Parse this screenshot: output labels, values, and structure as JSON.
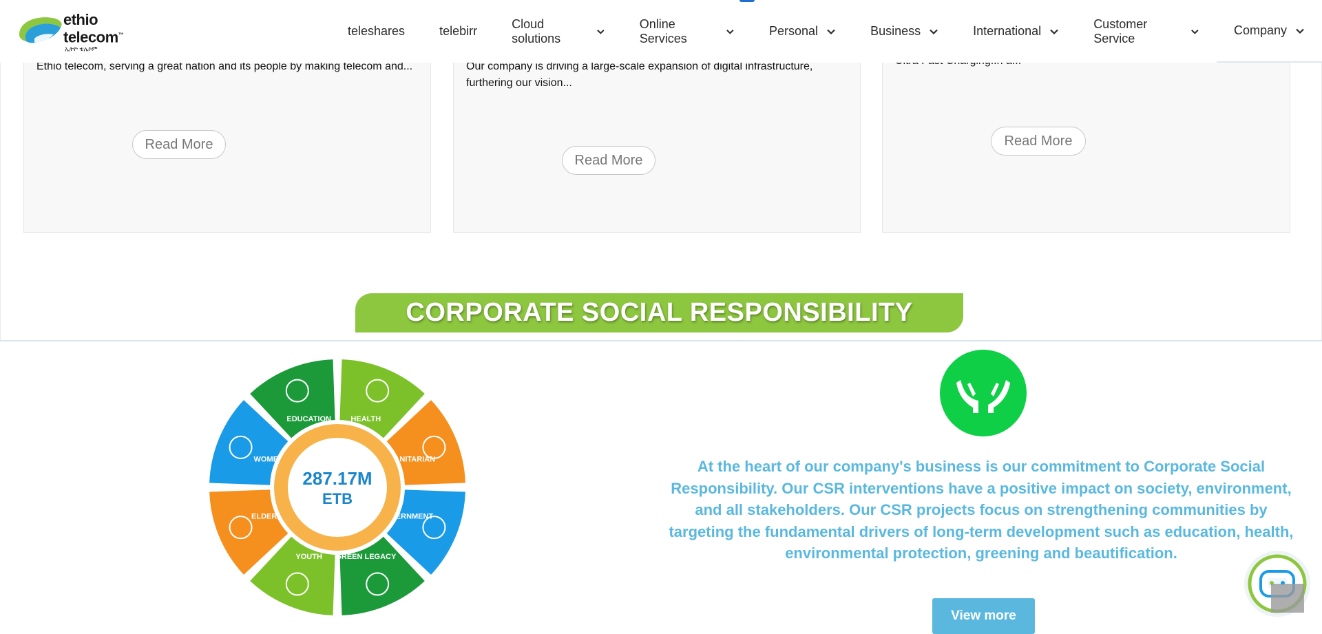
{
  "header": {
    "logo_name": "ethio telecom",
    "logo_tm": "™",
    "logo_sub": "ኢትዮ ቴሌኮም",
    "nav": [
      {
        "label": "teleshares",
        "dropdown": false
      },
      {
        "label": "telebirr",
        "dropdown": false
      },
      {
        "label": "Cloud solutions",
        "dropdown": true
      },
      {
        "label": "Online Services",
        "dropdown": true
      },
      {
        "label": "Personal",
        "dropdown": true
      },
      {
        "label": "Business",
        "dropdown": true
      },
      {
        "label": "International",
        "dropdown": true
      },
      {
        "label": "Customer Service",
        "dropdown": true
      },
      {
        "label": "Company",
        "dropdown": true
      }
    ]
  },
  "cards": [
    {
      "text": "Ethio telecom, serving a great nation and its people by making telecom and...",
      "read_more": "Read More"
    },
    {
      "text_line1": "Our company is driving a large-scale expansion of digital infrastructure,",
      "text_line2": "furthering our vision...",
      "read_more": "Read More"
    },
    {
      "text": "Ultra Fast Charging.In a...",
      "read_more": "Read More"
    }
  ],
  "csr": {
    "banner": "CORPORATE SOCIAL RESPONSIBILITY",
    "wheel_center_value": "287.17M",
    "wheel_center_unit": "ETB",
    "segments": [
      "HEALTH",
      "HUMANITARIAN",
      "GOVERNMENT",
      "GREEN LEGACY",
      "YOUTH",
      "ELDERLY",
      "WOMEN",
      "EDUCATION"
    ],
    "description": "At the heart of our company's business is our commitment to Corporate Social Responsibility. Our CSR interventions have a positive impact on society, environment, and all stakeholders. Our CSR projects focus on strengthening communities by targeting the fundamental drivers of long-term development such as education, health, environmental protection, greening and beautification.",
    "view_more": "View more"
  },
  "colors": {
    "brand_green": "#8dc63f",
    "csr_text": "#5ab8df",
    "hands_circle": "#0ecf45",
    "wheel_green": "#1c9a3a",
    "wheel_lightgreen": "#7cc12a",
    "wheel_orange": "#f5901e",
    "wheel_blue": "#1a9be8"
  },
  "icons": {
    "logo": "ethio-telecom-logo",
    "hands": "caring-hands-icon",
    "chat": "chatbot-icon",
    "chevron": "chevron-down-icon"
  }
}
